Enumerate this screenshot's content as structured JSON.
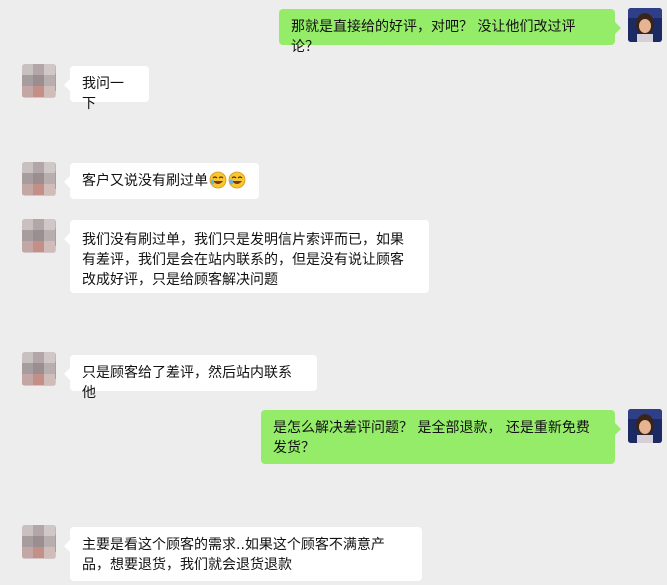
{
  "colors": {
    "background": "#ededed",
    "incoming_bubble": "#ffffff",
    "outgoing_bubble": "#95ec69",
    "text": "#111111"
  },
  "messages": [
    {
      "side": "right",
      "text": "那就是直接给的好评，对吧？ 没让他们改过评论？"
    },
    {
      "side": "left",
      "text": "我问一下"
    },
    {
      "side": "left",
      "text": "客户又说没有刷过单",
      "emojis": [
        "rolling-laughing-emoji",
        "rolling-laughing-emoji"
      ]
    },
    {
      "side": "left",
      "text": "我们没有刷过单，我们只是发明信片索评而已，如果有差评，我们是会在站内联系的，但是没有说让顾客改成好评，只是给顾客解决问题"
    },
    {
      "side": "left",
      "text": "只是顾客给了差评，然后站内联系他"
    },
    {
      "side": "right",
      "text": "是怎么解决差评问题？ 是全部退款， 还是重新免费发货？"
    },
    {
      "side": "left",
      "text": "主要是看这个顾客的需求..如果这个顾客不满意产品，想要退货，我们就会退货退款"
    }
  ]
}
